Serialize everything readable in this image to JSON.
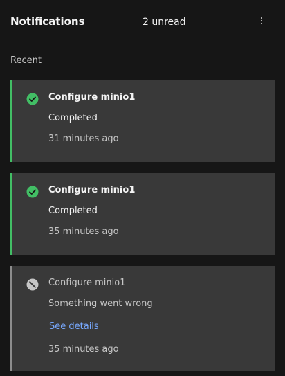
{
  "header": {
    "title": "Notifications",
    "unread_label": "2 unread",
    "menu_icon": "overflow-menu-vertical-icon"
  },
  "section": {
    "label": "Recent"
  },
  "notifications": [
    {
      "icon": "checkmark-filled-icon",
      "status_color": "#42be65",
      "title": "Configure minio1",
      "status": "Completed",
      "time": "31 minutes ago"
    },
    {
      "icon": "checkmark-filled-icon",
      "status_color": "#42be65",
      "title": "Configure minio1",
      "status": "Completed",
      "time": "35 minutes ago"
    },
    {
      "icon": "blocked-icon",
      "status_color": "#8d8d8d",
      "title": "Configure minio1",
      "status": "Something went wrong",
      "link_label": "See details",
      "time": "35 minutes ago"
    }
  ]
}
